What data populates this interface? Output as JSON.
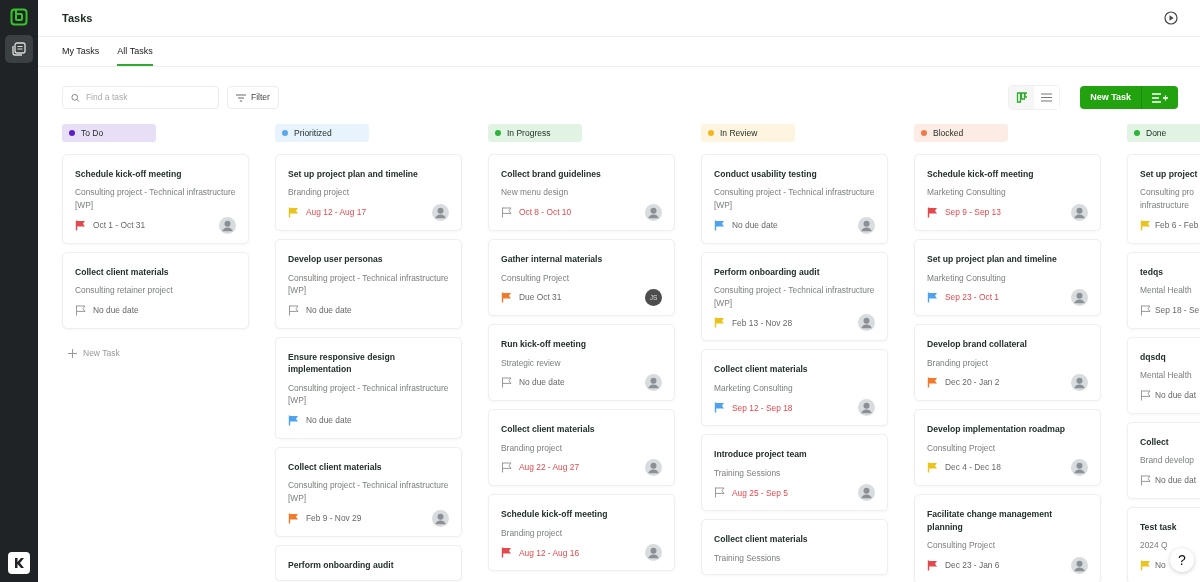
{
  "page_title": "Tasks",
  "tabs": [
    {
      "label": "My Tasks",
      "selected": false
    },
    {
      "label": "All Tasks",
      "selected": true
    }
  ],
  "search": {
    "placeholder": "Find a task"
  },
  "filter_button": "Filter",
  "view_toggle": [
    {
      "kind": "board",
      "selected": true
    },
    {
      "kind": "list",
      "selected": false
    }
  ],
  "new_task_button": "New Task",
  "help_button": "?",
  "columns": [
    {
      "name": "To Do",
      "color": "#5b1fc7",
      "add_label": "New Task",
      "cards": [
        {
          "title": "Schedule kick-off meeting",
          "project": "Consulting project - Technical infrastructure [WP]",
          "flag": {
            "color": "#e5484d",
            "filled": true
          },
          "date": "Oct 1 - Oct 31",
          "overdue": false,
          "avatar": true
        },
        {
          "title": "Collect client materials",
          "project": "Consulting retainer project",
          "flag": {
            "color": "#999999",
            "filled": false
          },
          "date": "No due date",
          "overdue": false,
          "avatar": false
        }
      ]
    },
    {
      "name": "Prioritized",
      "color": "#5aa7ef",
      "cards": [
        {
          "title": "Set up project plan and timeline",
          "project": "Branding project",
          "flag": {
            "color": "#ecc31c",
            "filled": true
          },
          "date": "Aug 12 - Aug 17",
          "overdue": true,
          "avatar": true
        },
        {
          "title": "Develop user personas",
          "project": "Consulting project - Technical infrastructure [WP]",
          "flag": {
            "color": "#999999",
            "filled": false
          },
          "date": "No due date",
          "overdue": false,
          "avatar": false
        },
        {
          "title": "Ensure responsive design implementation",
          "project": "Consulting project - Technical infrastructure [WP]",
          "flag": {
            "color": "#4ea2ee",
            "filled": true
          },
          "date": "No due date",
          "overdue": false,
          "avatar": false
        },
        {
          "title": "Collect client materials",
          "project": "Consulting project - Technical infrastructure [WP]",
          "flag": {
            "color": "#ef7b2c",
            "filled": true
          },
          "date": "Feb 9 - Nov 29",
          "overdue": false,
          "avatar": true
        },
        {
          "title": "Perform onboarding audit"
        }
      ]
    },
    {
      "name": "In Progress",
      "color": "#2bb33a",
      "cards": [
        {
          "title": "Collect brand guidelines",
          "project": "New menu design",
          "flag": {
            "color": "#999999",
            "filled": false
          },
          "date": "Oct 8 - Oct 10",
          "overdue": true,
          "avatar": true
        },
        {
          "title": "Gather internal materials",
          "project": "Consulting Project",
          "flag": {
            "color": "#ef7b2c",
            "filled": true
          },
          "date": "Due Oct 31",
          "overdue": false,
          "initials": "JS"
        },
        {
          "title": "Run kick-off meeting",
          "project": "Strategic review",
          "flag": {
            "color": "#999999",
            "filled": false
          },
          "date": "No due date",
          "overdue": false,
          "avatar": true
        },
        {
          "title": "Collect client materials",
          "project": "Branding project",
          "flag": {
            "color": "#999999",
            "filled": false
          },
          "date": "Aug 22 - Aug 27",
          "overdue": true,
          "avatar": true
        },
        {
          "title": "Schedule kick-off meeting",
          "project": "Branding project",
          "flag": {
            "color": "#e5484d",
            "filled": true
          },
          "date": "Aug 12 - Aug 16",
          "overdue": true,
          "avatar": true
        }
      ]
    },
    {
      "name": "In Review",
      "color": "#f2b61d",
      "cards": [
        {
          "title": "Conduct usability testing",
          "project": "Consulting project - Technical infrastructure [WP]",
          "flag": {
            "color": "#4ea2ee",
            "filled": true
          },
          "date": "No due date",
          "overdue": false,
          "avatar": true
        },
        {
          "title": "Perform onboarding audit",
          "project": "Consulting project - Technical infrastructure [WP]",
          "flag": {
            "color": "#ecc31c",
            "filled": true
          },
          "date": "Feb 13 - Nov 28",
          "overdue": false,
          "avatar": true
        },
        {
          "title": "Collect client materials",
          "project": "Marketing Consulting",
          "flag": {
            "color": "#4ea2ee",
            "filled": true
          },
          "date": "Sep 12 - Sep 18",
          "overdue": true,
          "avatar": true
        },
        {
          "title": "Introduce project team",
          "project": "Training Sessions",
          "flag": {
            "color": "#999999",
            "filled": false
          },
          "date": "Aug 25 - Sep 5",
          "overdue": true,
          "avatar": true
        },
        {
          "title": "Collect client materials",
          "project": "Training Sessions"
        }
      ]
    },
    {
      "name": "Blocked",
      "color": "#ef7b4c",
      "cards": [
        {
          "title": "Schedule kick-off meeting",
          "project": "Marketing Consulting",
          "flag": {
            "color": "#e5484d",
            "filled": true
          },
          "date": "Sep 9 - Sep 13",
          "overdue": true,
          "avatar": true
        },
        {
          "title": "Set up project plan and timeline",
          "project": "Marketing Consulting",
          "flag": {
            "color": "#4ea2ee",
            "filled": true
          },
          "date": "Sep 23 - Oct 1",
          "overdue": true,
          "avatar": true
        },
        {
          "title": "Develop brand collateral",
          "project": "Branding project",
          "flag": {
            "color": "#ef7b2c",
            "filled": true
          },
          "date": "Dec 20 - Jan 2",
          "overdue": false,
          "avatar": true
        },
        {
          "title": "Develop implementation roadmap",
          "project": "Consulting Project",
          "flag": {
            "color": "#ecc31c",
            "filled": true
          },
          "date": "Dec 4 - Dec 18",
          "overdue": false,
          "avatar": true
        },
        {
          "title": "Facilitate change management planning",
          "project": "Consulting Project",
          "flag": {
            "color": "#e5484d",
            "filled": true
          },
          "date": "Dec 23 - Jan 6",
          "overdue": false,
          "avatar": true
        }
      ]
    },
    {
      "name": "Done",
      "color": "#2bb33a",
      "cards": [
        {
          "title": "Set up project",
          "project": "Consulting pro infrastructure",
          "flag": {
            "color": "#ecc31c",
            "filled": true
          },
          "date": "Feb 6 - Feb",
          "overdue": false,
          "avatar": false
        },
        {
          "title": "tedqs",
          "project": "Mental Health",
          "flag": {
            "color": "#999999",
            "filled": false
          },
          "date": "Sep 18 - Se",
          "overdue": false,
          "avatar": false
        },
        {
          "title": "dqsdq",
          "project": "Mental Health",
          "flag": {
            "color": "#999999",
            "filled": false
          },
          "date": "No due dat",
          "overdue": false,
          "avatar": false
        },
        {
          "title": "Collect",
          "project": "Brand develop",
          "flag": {
            "color": "#999999",
            "filled": false
          },
          "date": "No due dat",
          "overdue": false,
          "avatar": false
        },
        {
          "title": "Test task",
          "project": "2024 Q",
          "flag": {
            "color": "#ecc31c",
            "filled": true
          },
          "date": "No",
          "overdue": false,
          "avatar": false
        }
      ]
    }
  ]
}
